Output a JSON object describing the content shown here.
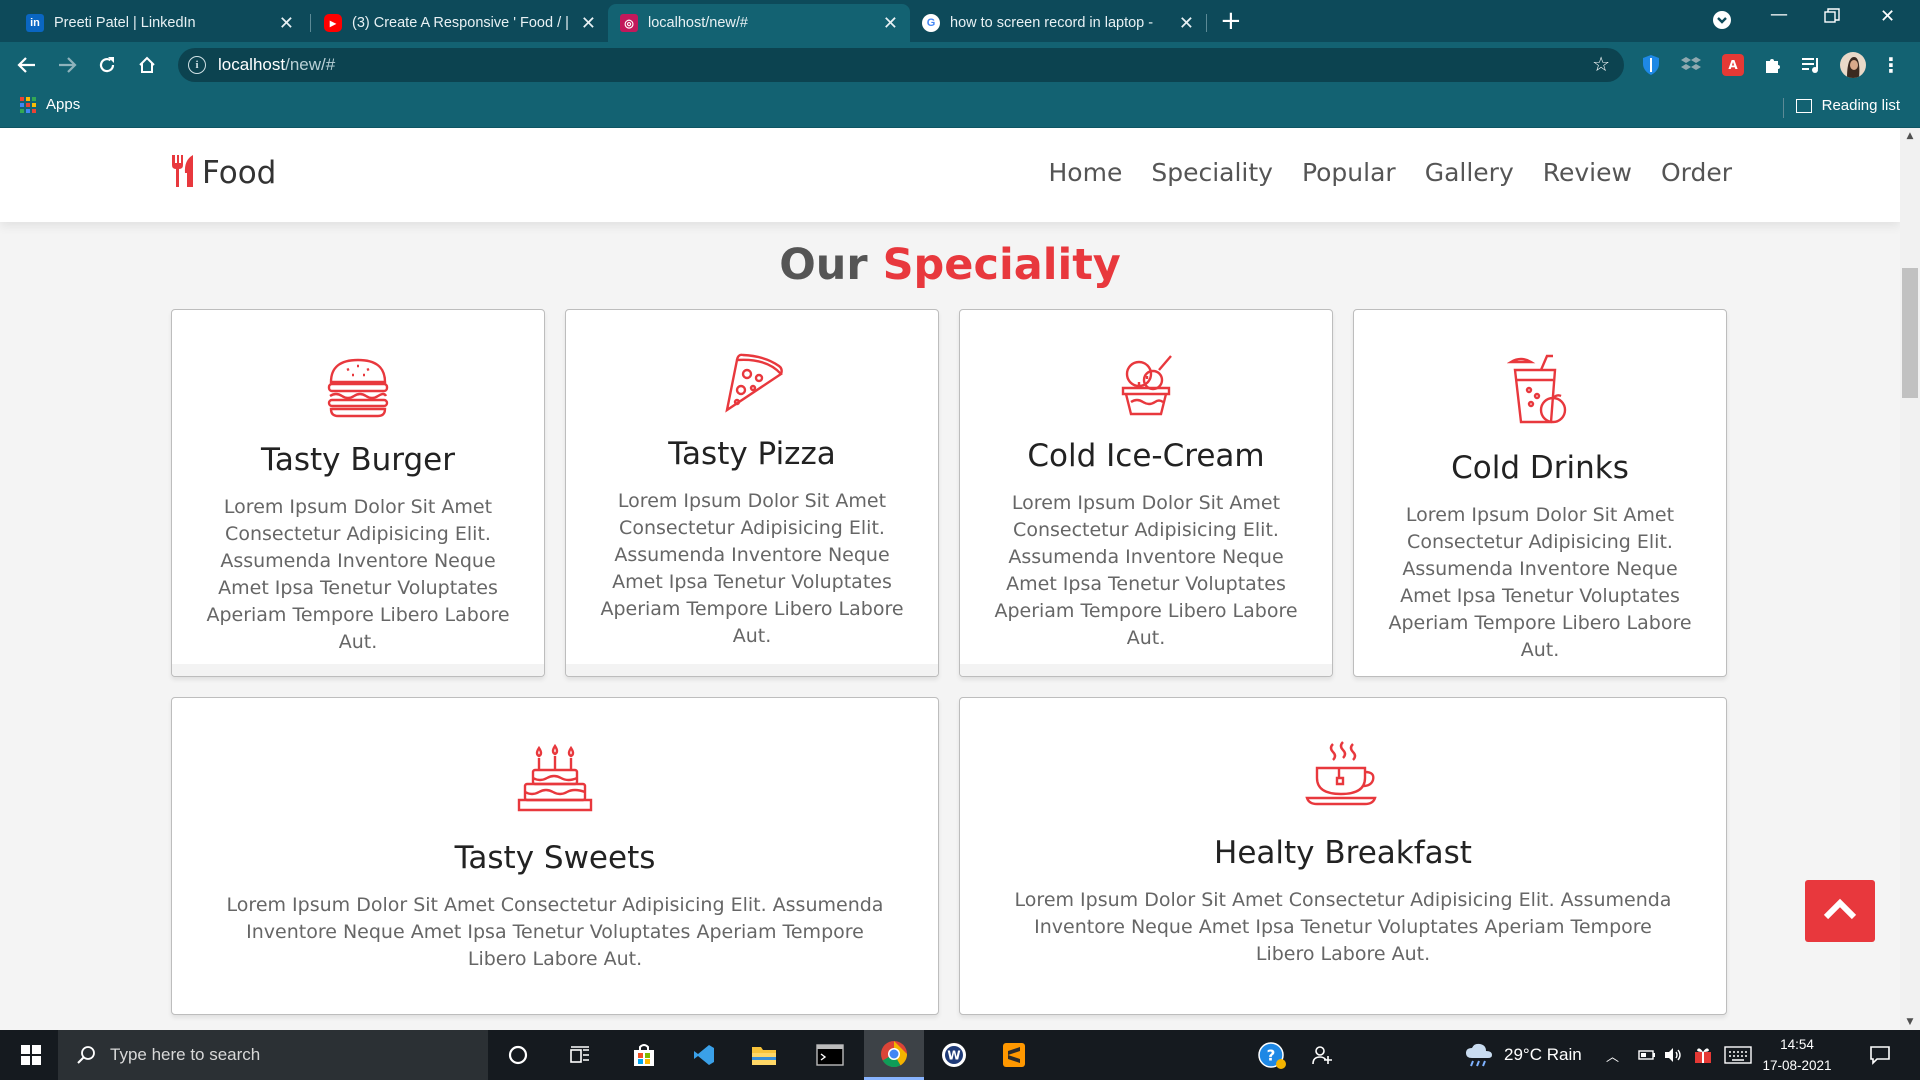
{
  "browser": {
    "tabs": [
      {
        "title": "Preeti Patel | LinkedIn",
        "favicon": "linkedin-icon"
      },
      {
        "title": "(3) Create A Responsive ' Food / |",
        "favicon": "youtube-icon"
      },
      {
        "title": "localhost/new/#",
        "favicon": "localhost-icon"
      },
      {
        "title": "how to screen record in laptop -",
        "favicon": "google-icon"
      }
    ],
    "active_tab": 2,
    "url": "localhost",
    "url_path": "/new/#",
    "bookmarks_apps": "Apps",
    "reading_list": "Reading list"
  },
  "site": {
    "logo": "Food",
    "nav": [
      "Home",
      "Speciality",
      "Popular",
      "Gallery",
      "Review",
      "Order"
    ],
    "heading_plain": "Our",
    "heading_accent": "Speciality",
    "cards": [
      {
        "title": "Tasty Burger",
        "icon": "burger-icon",
        "text": "Lorem Ipsum Dolor Sit Amet Consectetur Adipisicing Elit. Assumenda Inventore Neque Amet Ipsa Tenetur Voluptates Aperiam Tempore Libero Labore Aut."
      },
      {
        "title": "Tasty Pizza",
        "icon": "pizza-icon",
        "text": "Lorem Ipsum Dolor Sit Amet Consectetur Adipisicing Elit. Assumenda Inventore Neque Amet Ipsa Tenetur Voluptates Aperiam Tempore Libero Labore Aut."
      },
      {
        "title": "Cold Ice-Cream",
        "icon": "ice-cream-icon",
        "text": "Lorem Ipsum Dolor Sit Amet Consectetur Adipisicing Elit. Assumenda Inventore Neque Amet Ipsa Tenetur Voluptates Aperiam Tempore Libero Labore Aut."
      },
      {
        "title": "Cold Drinks",
        "icon": "drink-icon",
        "text": "Lorem Ipsum Dolor Sit Amet Consectetur Adipisicing Elit. Assumenda Inventore Neque Amet Ipsa Tenetur Voluptates Aperiam Tempore Libero Labore Aut."
      },
      {
        "title": "Tasty Sweets",
        "icon": "cake-icon",
        "text": "Lorem Ipsum Dolor Sit Amet Consectetur Adipisicing Elit. Assumenda Inventore Neque Amet Ipsa Tenetur Voluptates Aperiam Tempore Libero Labore Aut."
      },
      {
        "title": "Healty Breakfast",
        "icon": "coffee-cup-icon",
        "text": "Lorem Ipsum Dolor Sit Amet Consectetur Adipisicing Elit. Assumenda Inventore Neque Amet Ipsa Tenetur Voluptates Aperiam Tempore Libero Labore Aut."
      }
    ],
    "accent_color": "#e8383d"
  },
  "taskbar": {
    "search_placeholder": "Type here to search",
    "weather": "29°C  Rain",
    "time": "14:54",
    "date": "17-08-2021"
  },
  "colors": {
    "chrome_frame": "#0d4a5a",
    "chrome_toolbar": "#136272",
    "taskbar": "#151a1f"
  }
}
